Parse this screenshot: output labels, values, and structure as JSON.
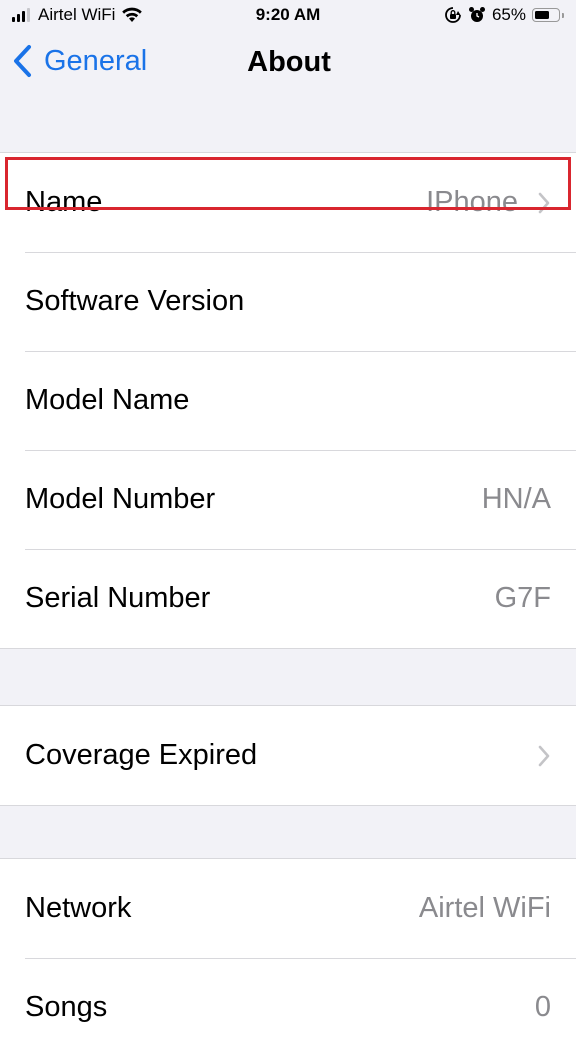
{
  "status_bar": {
    "carrier": "Airtel WiFi",
    "time": "9:20 AM",
    "battery_percent_label": "65%",
    "battery_level": 0.65,
    "icons": [
      "signal-icon",
      "wifi-icon",
      "orientation-lock-icon",
      "alarm-icon",
      "battery-icon"
    ]
  },
  "nav": {
    "back_label": "General",
    "title": "About"
  },
  "groups": [
    {
      "rows": [
        {
          "label": "Name",
          "value": "IPhone",
          "chevron": true,
          "highlighted": true
        },
        {
          "label": "Software Version",
          "value": ""
        },
        {
          "label": "Model Name",
          "value": ""
        },
        {
          "label": "Model Number",
          "value": "HN/A"
        },
        {
          "label": "Serial Number",
          "value": "G7F"
        }
      ]
    },
    {
      "rows": [
        {
          "label": "Coverage Expired",
          "value": "",
          "chevron": true
        }
      ]
    },
    {
      "rows": [
        {
          "label": "Network",
          "value": "Airtel WiFi"
        },
        {
          "label": "Songs",
          "value": "0"
        }
      ]
    }
  ],
  "colors": {
    "accent": "#1a73e8",
    "highlight_border": "#d9262f",
    "secondary_text": "#8a8a8e",
    "background": "#f2f2f7"
  }
}
